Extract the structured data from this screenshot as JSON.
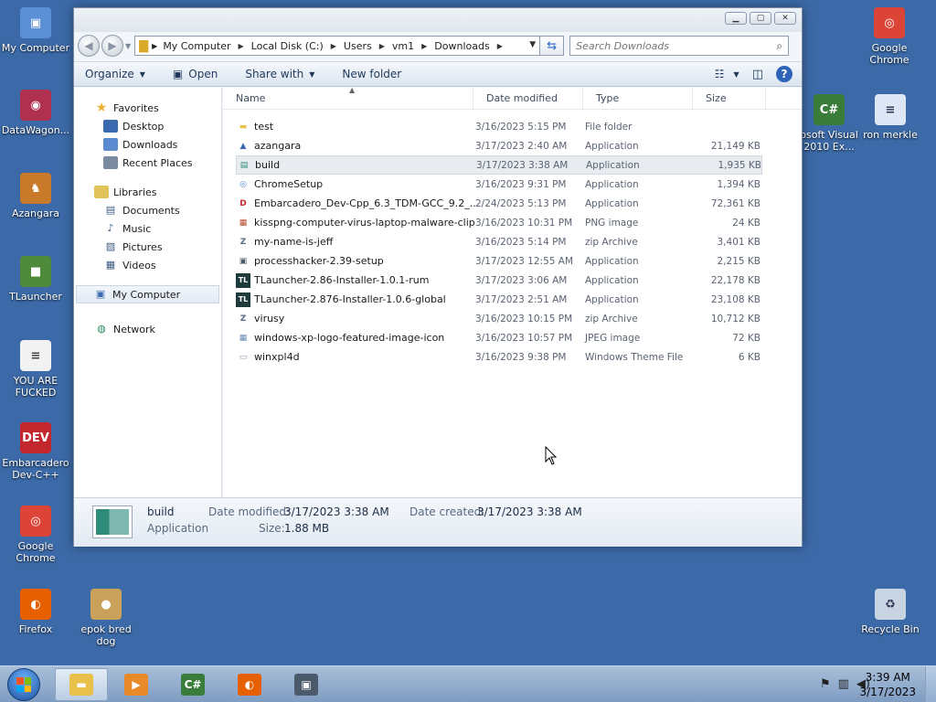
{
  "desktop": {
    "left_icons": [
      {
        "label": "My Computer",
        "icon": "computer-icon",
        "color": "#5b8fd6",
        "glyph": "▣"
      },
      {
        "label": "DataWagon...",
        "icon": "datawagon-icon",
        "color": "#b03050",
        "glyph": "◉"
      },
      {
        "label": "Azangara",
        "icon": "azangara-icon",
        "color": "#c87a2a",
        "glyph": "♞"
      },
      {
        "label": "TLauncher",
        "icon": "tlauncher-icon",
        "color": "#4f8a3a",
        "glyph": "■"
      },
      {
        "label": "YOU ARE FUCKED",
        "icon": "text-document-icon",
        "color": "#f2f2f2",
        "glyph": "≡"
      },
      {
        "label": "Embarcadero Dev-C++",
        "icon": "devcpp-icon",
        "color": "#c4262e",
        "glyph": "DEV"
      },
      {
        "label": "Google Chrome",
        "icon": "chrome-icon",
        "color": "#db4437",
        "glyph": "◎"
      },
      {
        "label": "Firefox",
        "icon": "firefox-icon",
        "color": "#e66000",
        "glyph": "◐"
      }
    ],
    "right_icons": [
      {
        "label": "Google Chrome",
        "icon": "chrome-icon",
        "color": "#db4437",
        "glyph": "◎"
      },
      {
        "label": "osoft Visual 2010 Ex...",
        "icon": "visual-csharp-icon",
        "color": "#3a7d3a",
        "glyph": "C#"
      },
      {
        "label": "ron merkle",
        "icon": "document-icon",
        "color": "#dce6f4",
        "glyph": "≡"
      },
      {
        "label": "Recycle Bin",
        "icon": "recycle-bin-icon",
        "color": "#c8d4e2",
        "glyph": "♻"
      }
    ],
    "extra_icon": {
      "label": "epok bred dog",
      "icon": "bread-dog-icon",
      "color": "#c9a15a",
      "glyph": "●"
    }
  },
  "window": {
    "breadcrumbs": [
      "My Computer",
      "Local Disk (C:)",
      "Users",
      "vm1",
      "Downloads"
    ],
    "search_placeholder": "Search Downloads",
    "toolbar": {
      "organize": "Organize",
      "open": "Open",
      "share_with": "Share with",
      "new_folder": "New folder"
    },
    "nav": {
      "favorites": "Favorites",
      "favorites_items": [
        "Desktop",
        "Downloads",
        "Recent Places"
      ],
      "libraries": "Libraries",
      "libraries_items": [
        "Documents",
        "Music",
        "Pictures",
        "Videos"
      ],
      "my_computer": "My Computer",
      "network": "Network"
    },
    "columns": {
      "name": "Name",
      "date": "Date modified",
      "type": "Type",
      "size": "Size"
    },
    "files": [
      {
        "name": "test",
        "date": "3/16/2023 5:15 PM",
        "type": "File folder",
        "size": "",
        "icon": "folder-icon",
        "color": "#e8c04a",
        "glyph": "▬"
      },
      {
        "name": "azangara",
        "date": "3/17/2023 2:40 AM",
        "type": "Application",
        "size": "21,149 KB",
        "icon": "azangara-app-icon",
        "color": "#3a6ab0",
        "glyph": "▲"
      },
      {
        "name": "build",
        "date": "3/17/2023 3:38 AM",
        "type": "Application",
        "size": "1,935 KB",
        "icon": "build-app-icon",
        "color": "#2e8b7a",
        "glyph": "▤"
      },
      {
        "name": "ChromeSetup",
        "date": "3/16/2023 9:31 PM",
        "type": "Application",
        "size": "1,394 KB",
        "icon": "chrome-setup-icon",
        "color": "#4a86c8",
        "glyph": "◎"
      },
      {
        "name": "Embarcadero_Dev-Cpp_6.3_TDM-GCC_9.2_...",
        "date": "2/24/2023 5:13 PM",
        "type": "Application",
        "size": "72,361 KB",
        "icon": "devcpp-setup-icon",
        "color": "#c4262e",
        "glyph": "D"
      },
      {
        "name": "kisspng-computer-virus-laptop-malware-clipa...",
        "date": "3/16/2023 10:31 PM",
        "type": "PNG image",
        "size": "24 KB",
        "icon": "png-image-icon",
        "color": "#b84a2a",
        "glyph": "▦"
      },
      {
        "name": "my-name-is-jeff",
        "date": "3/16/2023 5:14 PM",
        "type": "zip Archive",
        "size": "3,401 KB",
        "icon": "zip-archive-icon",
        "color": "#5a6a8a",
        "glyph": "Z"
      },
      {
        "name": "processhacker-2.39-setup",
        "date": "3/17/2023 12:55 AM",
        "type": "Application",
        "size": "2,215 KB",
        "icon": "processhacker-icon",
        "color": "#4a5a6a",
        "glyph": "▣"
      },
      {
        "name": "TLauncher-2.86-Installer-1.0.1-rum",
        "date": "3/17/2023 3:06 AM",
        "type": "Application",
        "size": "22,178 KB",
        "icon": "tlauncher-app-icon",
        "color": "#1f3a3a",
        "glyph": "TL"
      },
      {
        "name": "TLauncher-2.876-Installer-1.0.6-global",
        "date": "3/17/2023 2:51 AM",
        "type": "Application",
        "size": "23,108 KB",
        "icon": "tlauncher-app-icon",
        "color": "#1f3a3a",
        "glyph": "TL"
      },
      {
        "name": "virusy",
        "date": "3/16/2023 10:15 PM",
        "type": "zip Archive",
        "size": "10,712 KB",
        "icon": "zip-archive-icon",
        "color": "#5a6a8a",
        "glyph": "Z"
      },
      {
        "name": "windows-xp-logo-featured-image-icon",
        "date": "3/16/2023 10:57 PM",
        "type": "JPEG image",
        "size": "72 KB",
        "icon": "jpeg-image-icon",
        "color": "#6a8ab0",
        "glyph": "▦"
      },
      {
        "name": "winxpl4d",
        "date": "3/16/2023 9:38 PM",
        "type": "Windows Theme File",
        "size": "6 KB",
        "icon": "theme-file-icon",
        "color": "#8a9ab0",
        "glyph": "▭"
      }
    ],
    "selected_file": "build",
    "details": {
      "name": "build",
      "type": "Application",
      "date_modified_label": "Date modified:",
      "date_modified": "3/17/2023 3:38 AM",
      "date_created_label": "Date created:",
      "date_created": "3/17/2023 3:38 AM",
      "size_label": "Size:",
      "size": "1.88 MB"
    }
  },
  "taskbar": {
    "apps": [
      {
        "icon": "explorer-icon",
        "color": "#e8c04a",
        "glyph": "▬",
        "active": true
      },
      {
        "icon": "media-player-icon",
        "color": "#e88a2a",
        "glyph": "▶",
        "active": false
      },
      {
        "icon": "visual-csharp-icon",
        "color": "#3a7d3a",
        "glyph": "C#",
        "active": false
      },
      {
        "icon": "firefox-icon",
        "color": "#e66000",
        "glyph": "◐",
        "active": false
      },
      {
        "icon": "processhacker-icon",
        "color": "#4a5a6a",
        "glyph": "▣",
        "active": false
      }
    ],
    "time": "3:39 AM",
    "date": "3/17/2023"
  }
}
